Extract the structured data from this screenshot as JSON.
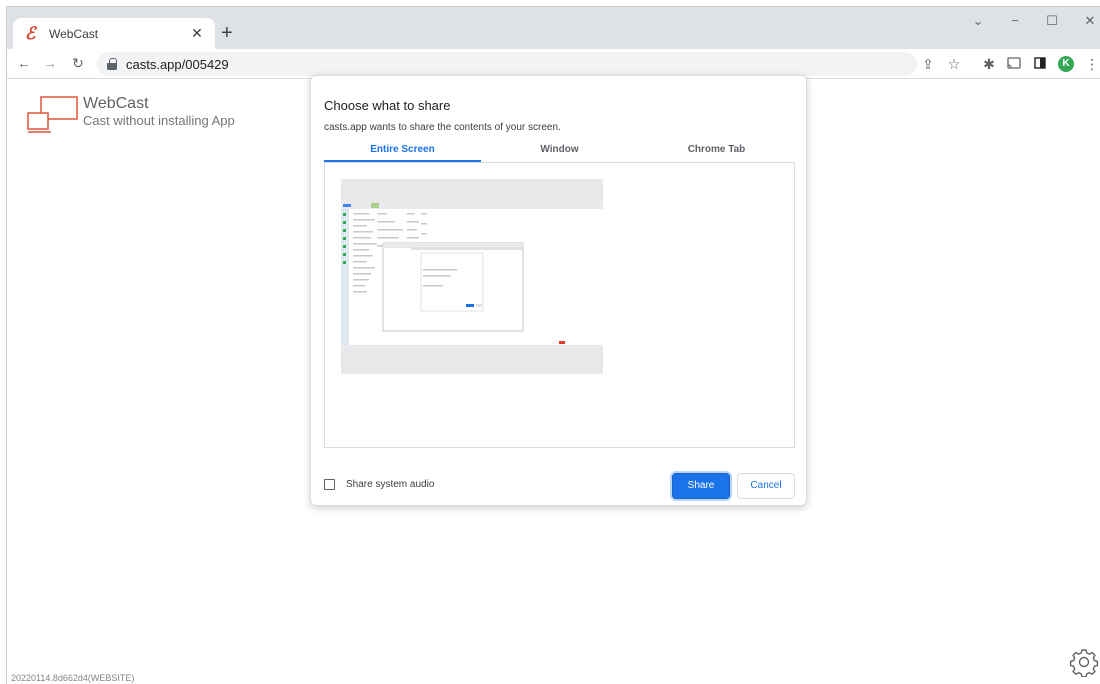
{
  "browser": {
    "tab": {
      "title": "WebCast",
      "favicon": "webcast-e-icon"
    },
    "url": "casts.app/005429",
    "avatar_initial": "K",
    "accent_color": "#1a73e8"
  },
  "page": {
    "brand_name": "WebCast",
    "brand_tagline": "Cast without installing App",
    "build_info": "20220114.8d662d4(WEBSITE)"
  },
  "dialog": {
    "title": "Choose what to share",
    "subtitle": "casts.app wants to share the contents of your screen.",
    "tabs": [
      {
        "label": "Entire Screen",
        "active": true
      },
      {
        "label": "Window",
        "active": false
      },
      {
        "label": "Chrome Tab",
        "active": false
      }
    ],
    "audio_checkbox_label": "Share system audio",
    "audio_checked": false,
    "share_label": "Share",
    "cancel_label": "Cancel"
  }
}
